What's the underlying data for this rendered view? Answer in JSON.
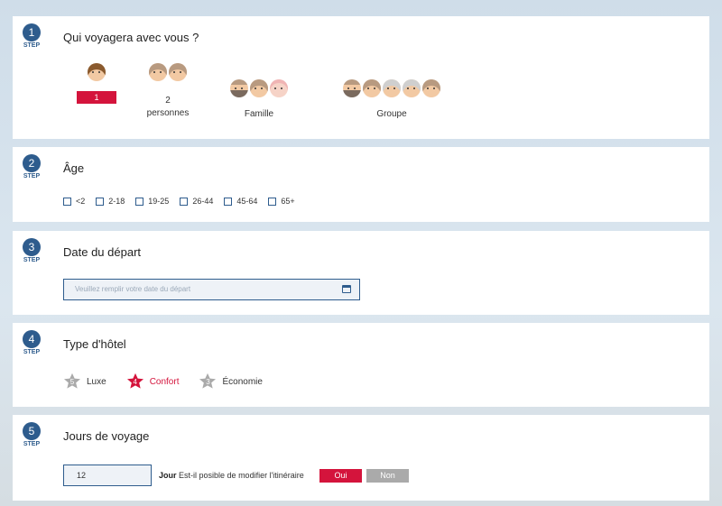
{
  "step_label": "STEP",
  "steps": [
    {
      "num": "1",
      "title": "Qui voyagera avec vous ?"
    },
    {
      "num": "2",
      "title": "Âge"
    },
    {
      "num": "3",
      "title": "Date du départ"
    },
    {
      "num": "4",
      "title": "Type d'hôtel"
    },
    {
      "num": "5",
      "title": "Jours de voyage"
    }
  ],
  "travelers": [
    {
      "label": "1",
      "selected": true
    },
    {
      "label_line1": "2",
      "label_line2": "personnes"
    },
    {
      "label": "Famille"
    },
    {
      "label": "Groupe"
    }
  ],
  "ages": [
    "<2",
    "2-18",
    "19-25",
    "26-44",
    "45-64",
    "65+"
  ],
  "date": {
    "placeholder": "Veuillez remplir votre date du départ"
  },
  "hotel": [
    {
      "stars": "5",
      "label": "Luxe",
      "color": "#aaaaaa",
      "text_color": "#333333"
    },
    {
      "stars": "4",
      "label": "Confort",
      "color": "#d4143c",
      "text_color": "#d4143c"
    },
    {
      "stars": "3",
      "label": "Économie",
      "color": "#aaaaaa",
      "text_color": "#333333"
    }
  ],
  "days": {
    "value": "12",
    "unit": "Jour",
    "question": "Est-il posible de modifier l'itinéraire",
    "yes": "Oui",
    "no": "Non",
    "yes_color": "#d4143c",
    "no_color": "#aaaaaa"
  },
  "icons": [
    "calendar-icon",
    "star-icon",
    "face-icon"
  ]
}
